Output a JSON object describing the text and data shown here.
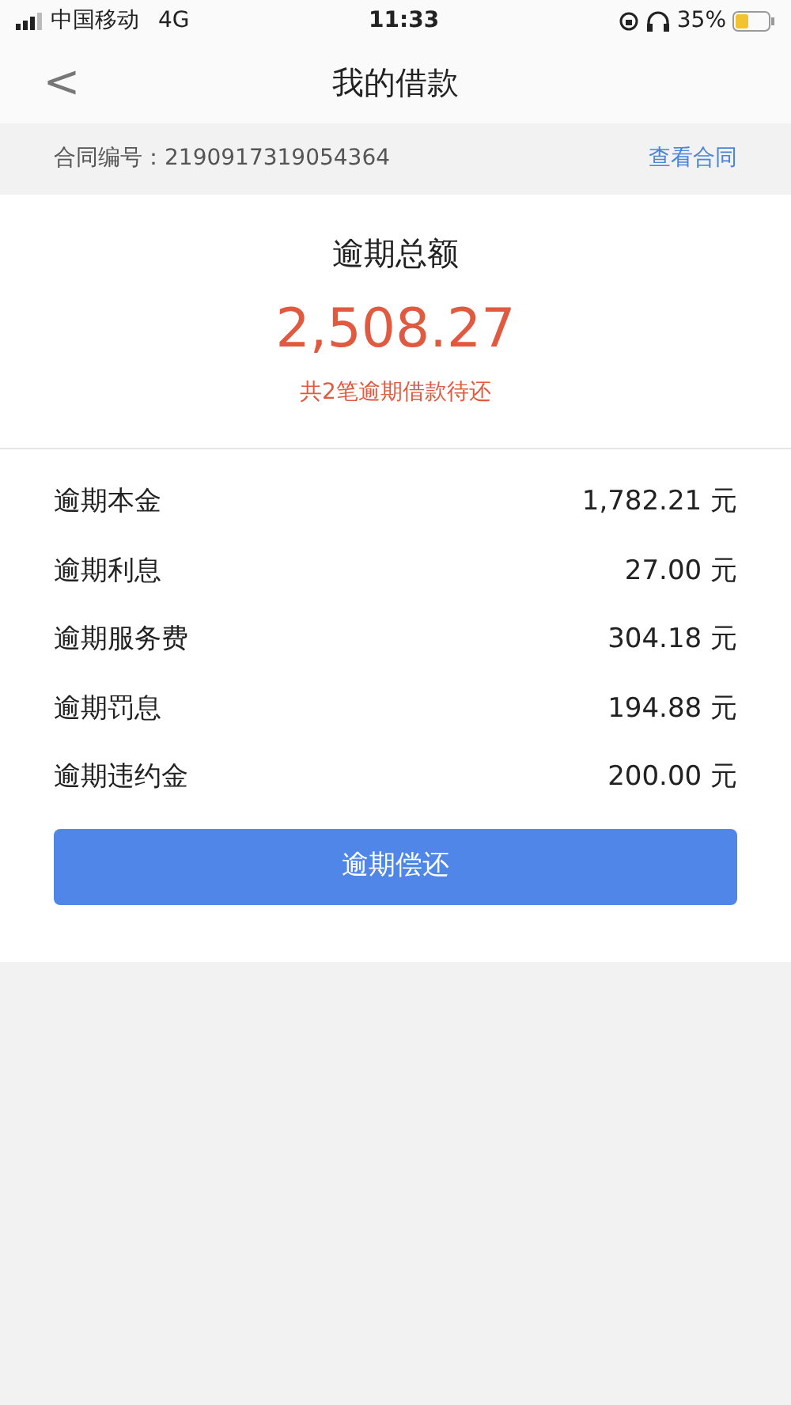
{
  "status_bar": {
    "carrier": "中国移动",
    "network": "4G",
    "time": "11:33",
    "battery": "35%"
  },
  "nav": {
    "back": "<",
    "title": "我的借款"
  },
  "contract": {
    "label": "合同编号：2190917319054364",
    "link": "查看合同"
  },
  "summary": {
    "title": "逾期总额",
    "amount": "2,508.27",
    "note": "共2笔逾期借款待还"
  },
  "items": [
    {
      "label": "逾期本金",
      "value": "1,782.21 元"
    },
    {
      "label": "逾期利息",
      "value": "27.00 元"
    },
    {
      "label": "逾期服务费",
      "value": "304.18 元"
    },
    {
      "label": "逾期罚息",
      "value": "194.88 元"
    },
    {
      "label": "逾期违约金",
      "value": "200.00 元"
    }
  ],
  "button": "逾期偿还"
}
